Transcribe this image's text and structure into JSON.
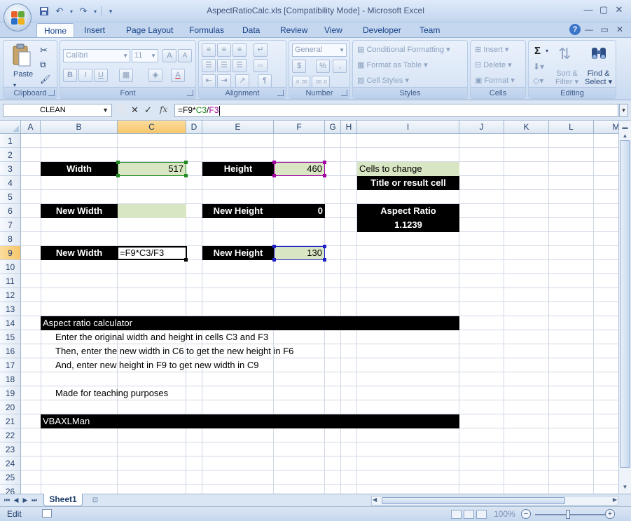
{
  "window": {
    "title": "AspectRatioCalc.xls  [Compatibility Mode] - Microsoft Excel",
    "controls": [
      "—",
      "▢",
      "✕"
    ]
  },
  "ribbon": {
    "tabs": [
      "Home",
      "Insert",
      "Page Layout",
      "Formulas",
      "Data",
      "Review",
      "View",
      "Developer",
      "Team"
    ],
    "active_tab": "Home",
    "groups": {
      "clipboard": {
        "label": "Clipboard",
        "paste": "Paste"
      },
      "font": {
        "label": "Font",
        "font_name": "Calibri",
        "font_size": "11",
        "grow": "A",
        "shrink": "A",
        "bold": "B",
        "italic": "I",
        "underline": "U",
        "font_color": "A"
      },
      "alignment": {
        "label": "Alignment"
      },
      "number": {
        "label": "Number",
        "format": "General",
        "currency": "$",
        "percent": "%",
        "comma": ",",
        "inc_decimal": ".0 .00",
        "dec_decimal": ".00 .0"
      },
      "styles": {
        "label": "Styles",
        "conditional": "Conditional Formatting",
        "format_table": "Format as Table",
        "cell_styles": "Cell Styles"
      },
      "cells": {
        "label": "Cells",
        "insert": "Insert",
        "delete": "Delete",
        "format": "Format"
      },
      "editing": {
        "label": "Editing",
        "sigma": "Σ",
        "sort_filter_1": "Sort &",
        "sort_filter_2": "Filter",
        "find_select_1": "Find &",
        "find_select_2": "Select"
      }
    }
  },
  "formula_bar": {
    "name_box": "CLEAN",
    "fx": "fx",
    "formula_parts": [
      "=F9*",
      "C3",
      "/",
      "F3"
    ]
  },
  "grid": {
    "columns": [
      "A",
      "B",
      "C",
      "D",
      "E",
      "F",
      "G",
      "H",
      "I",
      "J",
      "K",
      "L",
      "M"
    ],
    "rows": [
      "1",
      "2",
      "3",
      "4",
      "5",
      "6",
      "7",
      "8",
      "9",
      "10",
      "11",
      "12",
      "13",
      "14",
      "15",
      "16",
      "17",
      "18",
      "19",
      "20",
      "21",
      "22",
      "23",
      "24",
      "25",
      "26"
    ],
    "selected_column": "C",
    "selected_row": "9"
  },
  "cells": {
    "B3": "Width",
    "C3": "517",
    "E3": "Height",
    "F3": "460",
    "I3": "Cells to change",
    "I4": "Title or result cell",
    "B6": "New Width",
    "C6": "",
    "E6": "New Height",
    "F6": "0",
    "I6": "Aspect Ratio",
    "I7": "1.1239",
    "B9": "New Width",
    "C9": "=F9*C3/F3",
    "E9": "New Height",
    "F9": "130",
    "B14": "Aspect ratio calculator",
    "B15": "Enter the original width and height in cells C3 and F3",
    "B16": "Then, enter the new width in C6 to get the new height in F6",
    "B17": "And, enter new height in F9 to get new width in C9",
    "B19": "Made for teaching purposes",
    "B21": "VBAXLMan"
  },
  "colors": {
    "label_bg": "#000000",
    "input_bg": "#d9e6c3",
    "ref_c3": "#1f8a1f",
    "ref_f3": "#a000a0",
    "ref_f9": "#2020c8"
  },
  "sheets": [
    "Sheet1"
  ],
  "status": {
    "mode": "Edit",
    "zoom": "100%"
  }
}
